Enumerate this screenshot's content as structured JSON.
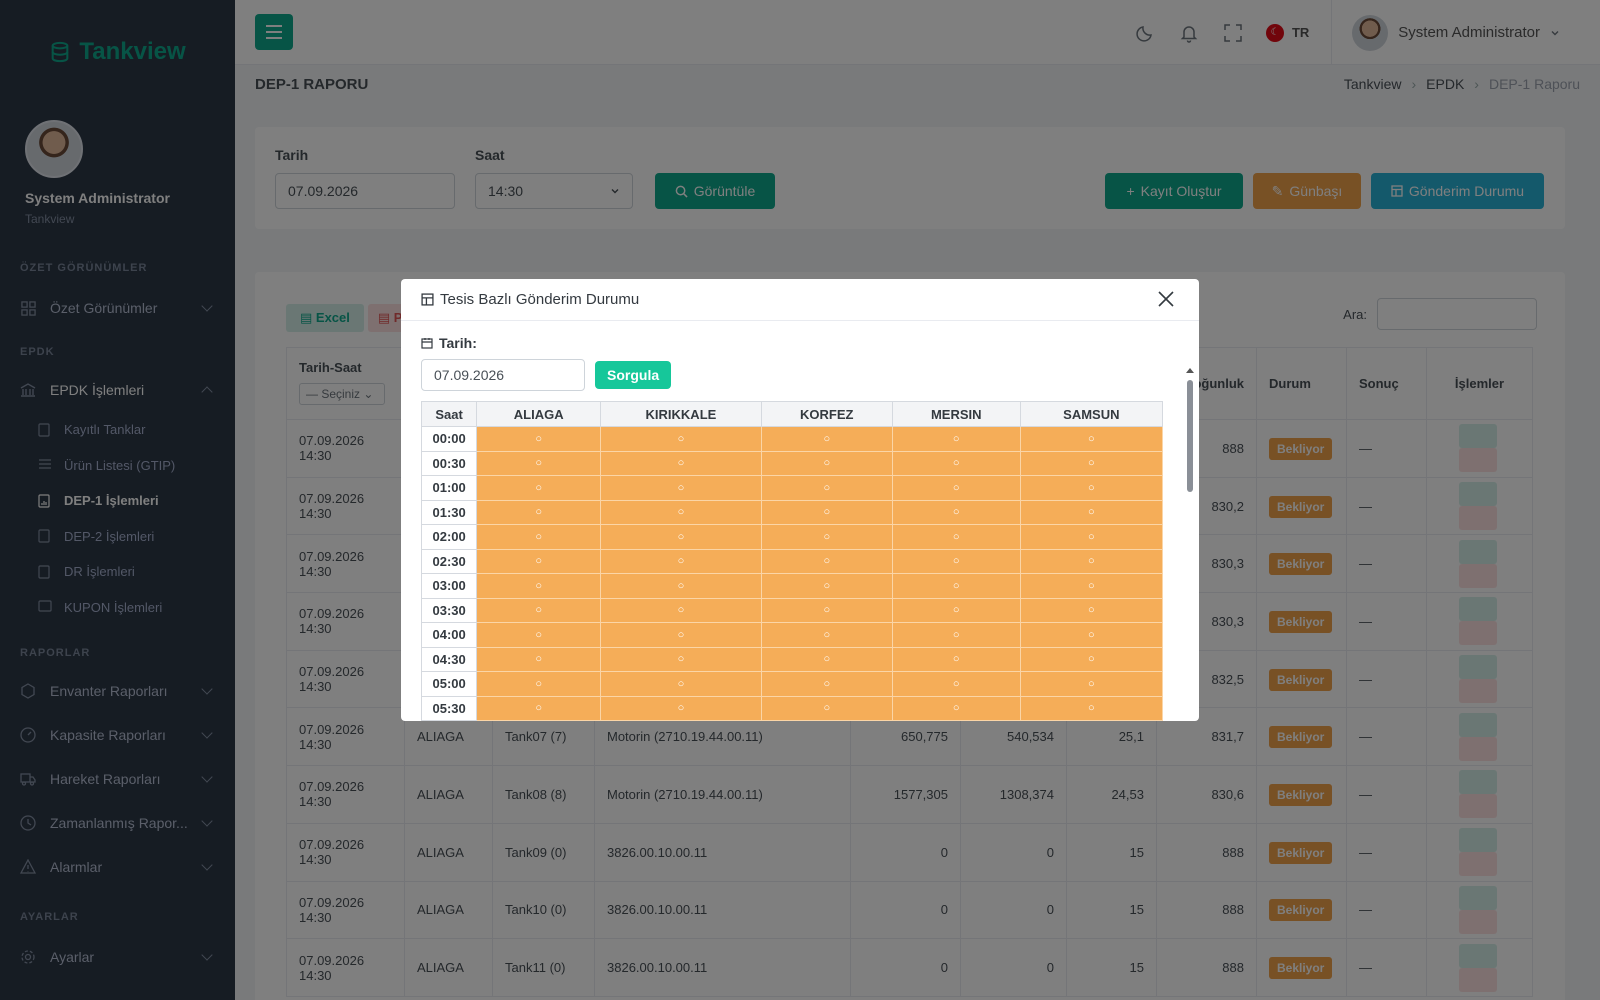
{
  "brand": "Tankview",
  "profile": {
    "name": "System Administrator",
    "sub": "Tankview"
  },
  "sidebar": {
    "sec1": "ÖZET GÖRÜNÜMLER",
    "ozet": "Özet Görünümler",
    "sec2": "EPDK",
    "epdk": "EPDK İşlemleri",
    "subs": [
      "Kayıtlı Tanklar",
      "Ürün Listesi (GTIP)",
      "DEP-1 İşlemleri",
      "DEP-2 İşlemleri",
      "DR İşlemleri",
      "KUPON İşlemleri"
    ],
    "sec3": "RAPORLAR",
    "reports": [
      "Envanter Raporları",
      "Kapasite Raporları",
      "Hareket Raporları",
      "Zamanlanmış Rapor...",
      "Alarmlar"
    ],
    "sec4": "AYARLAR",
    "settings": "Ayarlar"
  },
  "topbar": {
    "lang": "TR",
    "flag": "☾",
    "user": "System Administrator"
  },
  "page": {
    "title": "DEP-1 RAPORU",
    "crumbs": [
      "Tankview",
      "EPDK",
      "DEP-1 Raporu"
    ]
  },
  "filter": {
    "date_label": "Tarih",
    "date_value": "07.09.2026",
    "time_label": "Saat",
    "time_value": "14:30",
    "view": "Görüntüle",
    "create": "Kayıt Oluştur",
    "daystart": "Günbaşı",
    "status": "Gönderim Durumu"
  },
  "tablebar": {
    "excel": "Excel",
    "pdf": "P",
    "search": "Ara:"
  },
  "table": {
    "headers": [
      "Tarih-Saat",
      "Yoğunluk",
      "Durum",
      "Sonuç",
      "İşlemler"
    ],
    "select": "— Seçiniz",
    "rows": [
      {
        "date": "07.09.2026",
        "time": "14:30",
        "f": "",
        "t": "",
        "p": "",
        "a": "",
        "b": "",
        "c": "",
        "d": "888",
        "s": "Bekliyor",
        "r": "—"
      },
      {
        "date": "07.09.2026",
        "time": "14:30",
        "f": "",
        "t": "",
        "p": "",
        "a": "",
        "b": "",
        "c": "",
        "d": "830,2",
        "s": "Bekliyor",
        "r": "—"
      },
      {
        "date": "07.09.2026",
        "time": "14:30",
        "f": "",
        "t": "",
        "p": "",
        "a": "",
        "b": "",
        "c": "",
        "d": "830,3",
        "s": "Bekliyor",
        "r": "—"
      },
      {
        "date": "07.09.2026",
        "time": "14:30",
        "f": "",
        "t": "",
        "p": "",
        "a": "",
        "b": "",
        "c": "",
        "d": "830,3",
        "s": "Bekliyor",
        "r": "—"
      },
      {
        "date": "07.09.2026",
        "time": "14:30",
        "f": "",
        "t": "",
        "p": "",
        "a": "",
        "b": "",
        "c": "",
        "d": "832,5",
        "s": "Bekliyor",
        "r": "—"
      },
      {
        "date": "07.09.2026",
        "time": "14:30",
        "f": "ALIAGA",
        "t": "Tank07 (7)",
        "p": "Motorin (2710.19.44.00.11)",
        "a": "650,775",
        "b": "540,534",
        "c": "25,1",
        "d": "831,7",
        "s": "Bekliyor",
        "r": "—"
      },
      {
        "date": "07.09.2026",
        "time": "14:30",
        "f": "ALIAGA",
        "t": "Tank08 (8)",
        "p": "Motorin (2710.19.44.00.11)",
        "a": "1577,305",
        "b": "1308,374",
        "c": "24,53",
        "d": "830,6",
        "s": "Bekliyor",
        "r": "—"
      },
      {
        "date": "07.09.2026",
        "time": "14:30",
        "f": "ALIAGA",
        "t": "Tank09 (0)",
        "p": "3826.00.10.00.11",
        "a": "0",
        "b": "0",
        "c": "15",
        "d": "888",
        "s": "Bekliyor",
        "r": "—"
      },
      {
        "date": "07.09.2026",
        "time": "14:30",
        "f": "ALIAGA",
        "t": "Tank10 (0)",
        "p": "3826.00.10.00.11",
        "a": "0",
        "b": "0",
        "c": "15",
        "d": "888",
        "s": "Bekliyor",
        "r": "—"
      },
      {
        "date": "07.09.2026",
        "time": "14:30",
        "f": "ALIAGA",
        "t": "Tank11 (0)",
        "p": "3826.00.10.00.11",
        "a": "0",
        "b": "0",
        "c": "15",
        "d": "888",
        "s": "Bekliyor",
        "r": "—"
      }
    ]
  },
  "modal": {
    "title": "Tesis Bazlı Gönderim Durumu",
    "date_label": "Tarih:",
    "date_value": "07.09.2026",
    "query": "Sorgula",
    "columns": [
      "Saat",
      "ALIAGA",
      "KIRIKKALE",
      "KORFEZ",
      "MERSIN",
      "SAMSUN"
    ],
    "times": [
      "00:00",
      "00:30",
      "01:00",
      "01:30",
      "02:00",
      "02:30",
      "03:00",
      "03:30",
      "04:00",
      "04:30",
      "05:00",
      "05:30"
    ],
    "cell_mark": "○",
    "pending_color": "#f5ad58"
  }
}
